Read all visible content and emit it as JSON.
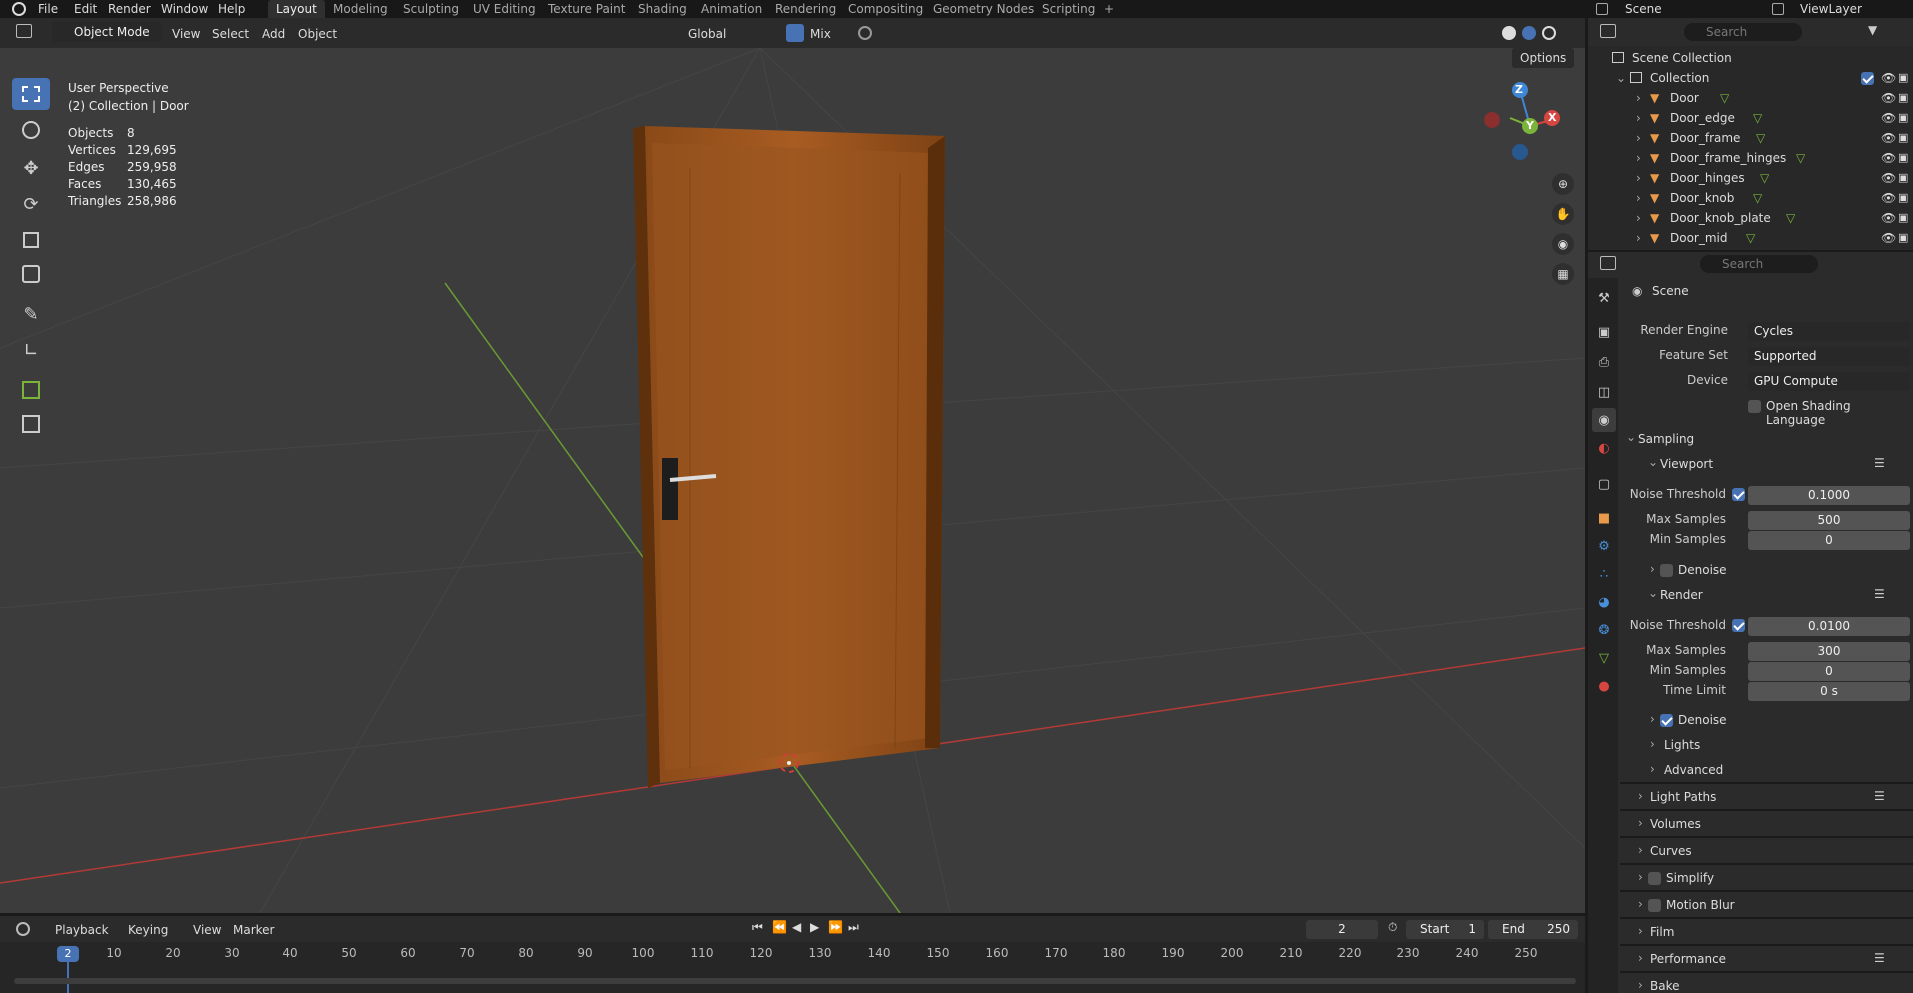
{
  "menubar": {
    "items": [
      "File",
      "Edit",
      "Render",
      "Window",
      "Help"
    ],
    "workspaces": [
      "Layout",
      "Modeling",
      "Sculpting",
      "UV Editing",
      "Texture Paint",
      "Shading",
      "Animation",
      "Rendering",
      "Compositing",
      "Geometry Nodes",
      "Scripting"
    ],
    "add_tab": "+",
    "scene_label": "Scene",
    "viewlayer_label": "ViewLayer"
  },
  "viewport_header": {
    "mode": "Object Mode",
    "menus": [
      "View",
      "Select",
      "Add",
      "Object"
    ],
    "orientation": "Global",
    "snap_mode": "Mix",
    "options_label": "Options"
  },
  "overlay": {
    "perspective": "User Perspective",
    "collection": "(2) Collection | Door",
    "stats": [
      {
        "label": "Objects",
        "value": "8"
      },
      {
        "label": "Vertices",
        "value": "129,695"
      },
      {
        "label": "Edges",
        "value": "259,958"
      },
      {
        "label": "Faces",
        "value": "130,465"
      },
      {
        "label": "Triangles",
        "value": "258,986"
      }
    ]
  },
  "gizmo": {
    "z": "Z",
    "y": "Y",
    "x": "X"
  },
  "timeline": {
    "menus": [
      "Playback",
      "Keying",
      "View",
      "Marker"
    ],
    "current_frame": "2",
    "start_label": "Start",
    "start_value": "1",
    "end_label": "End",
    "end_value": "250",
    "ruler_ticks": [
      "10",
      "20",
      "30",
      "40",
      "50",
      "60",
      "70",
      "80",
      "90",
      "100",
      "110",
      "120",
      "130",
      "140",
      "150",
      "160",
      "170",
      "180",
      "190",
      "200",
      "210",
      "220",
      "230",
      "240",
      "250"
    ]
  },
  "outliner": {
    "search_placeholder": "Search",
    "scene_collection": "Scene Collection",
    "collection": "Collection",
    "objects": [
      "Door",
      "Door_edge",
      "Door_frame",
      "Door_frame_hinges",
      "Door_hinges",
      "Door_knob",
      "Door_knob_plate",
      "Door_mid"
    ]
  },
  "properties": {
    "search_placeholder": "Search",
    "context": "Scene",
    "render_engine_label": "Render Engine",
    "render_engine": "Cycles",
    "feature_set_label": "Feature Set",
    "feature_set": "Supported",
    "device_label": "Device",
    "device": "GPU Compute",
    "osl_label": "Open Shading Language",
    "sampling": "Sampling",
    "viewport": "Viewport",
    "noise_threshold_label": "Noise Threshold",
    "vp_noise_threshold": "0.1000",
    "max_samples_label": "Max Samples",
    "vp_max_samples": "500",
    "min_samples_label": "Min Samples",
    "vp_min_samples": "0",
    "denoise_label": "Denoise",
    "render": "Render",
    "r_noise_threshold": "0.0100",
    "r_max_samples": "300",
    "r_min_samples": "0",
    "time_limit_label": "Time Limit",
    "r_time_limit": "0 s",
    "lights": "Lights",
    "advanced": "Advanced",
    "panels": [
      "Light Paths",
      "Volumes",
      "Curves",
      "Simplify",
      "Motion Blur",
      "Film",
      "Performance",
      "Bake"
    ]
  },
  "colors": {
    "accent": "#4772b3",
    "x_axis": "#d4463f",
    "y_axis": "#7bb33b",
    "z_axis": "#3f86d4",
    "object_orange": "#e89a4a"
  }
}
